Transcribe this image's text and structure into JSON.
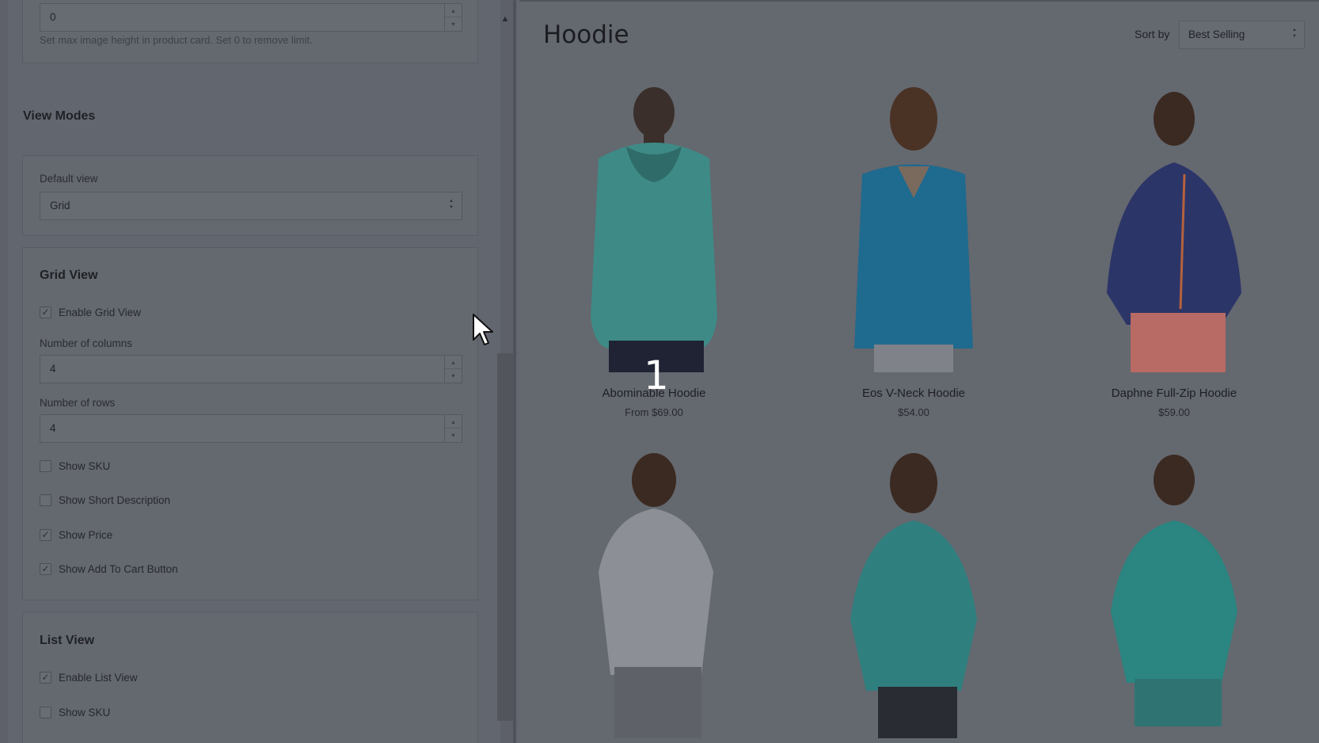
{
  "settings": {
    "image_height": {
      "value": "0",
      "help": "Set max image height in product card. Set 0 to remove limit."
    },
    "view_modes": {
      "heading": "View Modes",
      "default_view_label": "Default view",
      "default_view_value": "Grid"
    },
    "grid_view": {
      "heading": "Grid View",
      "enable_label": "Enable Grid View",
      "enable_checked": true,
      "columns_label": "Number of columns",
      "columns_value": "4",
      "rows_label": "Number of rows",
      "rows_value": "4",
      "show_sku_label": "Show SKU",
      "show_sku_checked": false,
      "show_short_desc_label": "Show Short Description",
      "show_short_desc_checked": false,
      "show_price_label": "Show Price",
      "show_price_checked": true,
      "show_add_to_cart_label": "Show Add To Cart Button",
      "show_add_to_cart_checked": true
    },
    "list_view": {
      "heading": "List View",
      "enable_label": "Enable List View",
      "enable_checked": true,
      "show_sku_label": "Show SKU",
      "show_sku_checked": false
    }
  },
  "storefront": {
    "title": "Hoodie",
    "sort_label": "Sort by",
    "sort_value": "Best Selling",
    "step_marker": "1",
    "products": [
      {
        "name": "Abominable Hoodie",
        "price": "From $69.00",
        "color": "#3e8a86"
      },
      {
        "name": "Eos V-Neck Hoodie",
        "price": "$54.00",
        "color": "#1f6a8f"
      },
      {
        "name": "Daphne Full-Zip Hoodie",
        "price": "$59.00",
        "color": "#2c3568"
      },
      {
        "name": "",
        "price": "",
        "color": "#8c8f95"
      },
      {
        "name": "",
        "price": "",
        "color": "#2f7f7e"
      },
      {
        "name": "",
        "price": "",
        "color": "#2b8580"
      }
    ]
  },
  "icons": {
    "check": "✓",
    "step_up": "▴",
    "step_down": "▾",
    "select_up": "▲",
    "select_down": "▼",
    "scroll_up": "▲"
  },
  "colors": {
    "overlay_bg": "#64686f",
    "panel_bg": "#62666e",
    "text": "#1c1e22"
  }
}
